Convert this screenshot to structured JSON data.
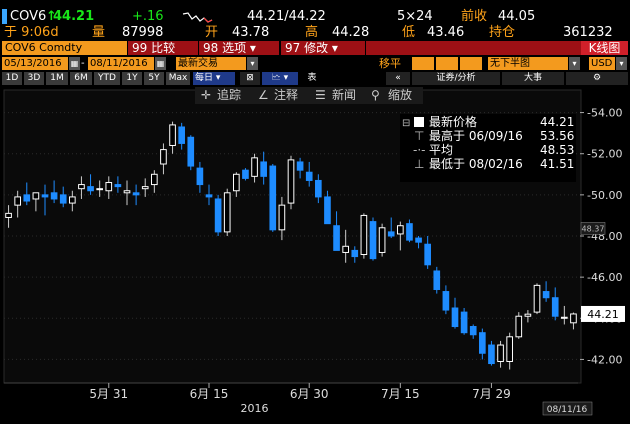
{
  "quote": {
    "ticker": "COV6",
    "last_price": "44.21",
    "change": "+.16",
    "bid_ask": "44.21/44.22",
    "size": "5×24",
    "prev_close_label": "前收",
    "prev_close": "44.05",
    "time": "于 9:06d",
    "volume_label": "量",
    "volume": "87998",
    "open_label": "开",
    "open": "43.78",
    "high_label": "高",
    "high": "44.28",
    "low_label": "低",
    "low": "43.46",
    "oi_label": "持仓",
    "oi": "361232"
  },
  "toolbar": {
    "security": "COV6 Comdty",
    "compare": "99 比较",
    "options": "98 选项 ▾",
    "edit": "97 修改 ▾",
    "chart_type": "K线图"
  },
  "dates": {
    "start": "05/13/2016",
    "end": "08/11/2016",
    "field": "最新交易",
    "shift_label": "移平",
    "currency_mode": "无下半图",
    "currency": "USD"
  },
  "ranges": [
    "1D",
    "3D",
    "1M",
    "6M",
    "YTD",
    "1Y",
    "5Y",
    "Max"
  ],
  "periodicity": "每日 ▾",
  "misc_buttons": {
    "compare_btn": "⊠",
    "type_btn": "🗠 ▾",
    "table_btn": "表",
    "collapse": "«",
    "events": "证券/分析",
    "annotate": "大事",
    "settings": "⚙"
  },
  "overlay_menu": {
    "track": "追踪",
    "annotate": "注释",
    "news": "新闻",
    "zoom": "缩放"
  },
  "legend": {
    "title": "最新价格",
    "last": "44.21",
    "high_label": "最高于 06/09/16",
    "high_value": "53.56",
    "avg_label": "平均",
    "avg_value": "48.53",
    "low_label": "最低于 08/02/16",
    "low_value": "41.51"
  },
  "chart_data": {
    "type": "candlestick",
    "y_ticks": [
      "54.00",
      "52.00",
      "50.00",
      "48.00",
      "46.00",
      "44.00",
      "42.00"
    ],
    "ylim": [
      41.0,
      55.0
    ],
    "x_ticks": [
      "5月 31",
      "6月 15",
      "6月 30",
      "7月 15",
      "7月 29"
    ],
    "year_label": "2016",
    "last_price_tag": "44.21",
    "ma_tag": "48.37",
    "end_date_tag": "08/11/16",
    "candles": [
      {
        "d": "05/13",
        "o": 48.9,
        "h": 49.5,
        "l": 48.4,
        "c": 49.1
      },
      {
        "d": "05/16",
        "o": 49.5,
        "h": 50.2,
        "l": 48.9,
        "c": 49.9
      },
      {
        "d": "05/17",
        "o": 50.0,
        "h": 50.6,
        "l": 49.5,
        "c": 49.7
      },
      {
        "d": "05/18",
        "o": 49.8,
        "h": 50.1,
        "l": 49.2,
        "c": 50.1
      },
      {
        "d": "05/19",
        "o": 50.0,
        "h": 50.5,
        "l": 49.0,
        "c": 49.9
      },
      {
        "d": "05/20",
        "o": 50.1,
        "h": 50.7,
        "l": 49.6,
        "c": 49.8
      },
      {
        "d": "05/23",
        "o": 50.0,
        "h": 50.4,
        "l": 49.4,
        "c": 49.6
      },
      {
        "d": "05/24",
        "o": 49.6,
        "h": 50.2,
        "l": 49.2,
        "c": 49.9
      },
      {
        "d": "05/25",
        "o": 50.3,
        "h": 50.9,
        "l": 49.8,
        "c": 50.5
      },
      {
        "d": "05/26",
        "o": 50.4,
        "h": 51.0,
        "l": 50.0,
        "c": 50.2
      },
      {
        "d": "05/27",
        "o": 50.3,
        "h": 50.7,
        "l": 49.9,
        "c": 50.3
      },
      {
        "d": "05/31",
        "o": 50.2,
        "h": 50.9,
        "l": 49.8,
        "c": 50.6
      },
      {
        "d": "06/01",
        "o": 50.5,
        "h": 50.9,
        "l": 50.1,
        "c": 50.4
      },
      {
        "d": "06/02",
        "o": 50.1,
        "h": 50.7,
        "l": 49.5,
        "c": 50.2
      },
      {
        "d": "06/03",
        "o": 50.1,
        "h": 50.5,
        "l": 49.5,
        "c": 50.0
      },
      {
        "d": "06/06",
        "o": 50.3,
        "h": 50.8,
        "l": 49.9,
        "c": 50.4
      },
      {
        "d": "06/07",
        "o": 50.5,
        "h": 51.2,
        "l": 50.1,
        "c": 51.0
      },
      {
        "d": "06/08",
        "o": 51.5,
        "h": 52.5,
        "l": 51.0,
        "c": 52.2
      },
      {
        "d": "06/09",
        "o": 52.4,
        "h": 53.56,
        "l": 52.0,
        "c": 53.4
      },
      {
        "d": "06/10",
        "o": 53.3,
        "h": 53.5,
        "l": 52.2,
        "c": 52.5
      },
      {
        "d": "06/13",
        "o": 52.8,
        "h": 52.9,
        "l": 51.2,
        "c": 51.4
      },
      {
        "d": "06/14",
        "o": 51.3,
        "h": 51.6,
        "l": 50.1,
        "c": 50.5
      },
      {
        "d": "06/15",
        "o": 50.0,
        "h": 50.5,
        "l": 49.5,
        "c": 49.9
      },
      {
        "d": "06/16",
        "o": 49.8,
        "h": 50.0,
        "l": 48.0,
        "c": 48.2
      },
      {
        "d": "06/17",
        "o": 48.2,
        "h": 50.3,
        "l": 48.0,
        "c": 50.1
      },
      {
        "d": "06/20",
        "o": 50.2,
        "h": 51.1,
        "l": 49.9,
        "c": 51.0
      },
      {
        "d": "06/21",
        "o": 51.2,
        "h": 51.3,
        "l": 50.7,
        "c": 50.8
      },
      {
        "d": "06/22",
        "o": 50.9,
        "h": 52.0,
        "l": 50.6,
        "c": 51.8
      },
      {
        "d": "06/23",
        "o": 51.6,
        "h": 52.1,
        "l": 50.5,
        "c": 50.9
      },
      {
        "d": "06/24",
        "o": 51.4,
        "h": 51.5,
        "l": 48.2,
        "c": 48.3
      },
      {
        "d": "06/27",
        "o": 48.3,
        "h": 49.9,
        "l": 47.8,
        "c": 49.5
      },
      {
        "d": "06/28",
        "o": 49.6,
        "h": 51.9,
        "l": 49.3,
        "c": 51.7
      },
      {
        "d": "06/29",
        "o": 51.6,
        "h": 51.8,
        "l": 50.8,
        "c": 51.2
      },
      {
        "d": "06/30",
        "o": 51.1,
        "h": 51.6,
        "l": 50.4,
        "c": 50.7
      },
      {
        "d": "07/01",
        "o": 50.7,
        "h": 51.0,
        "l": 49.6,
        "c": 49.9
      },
      {
        "d": "07/05",
        "o": 49.9,
        "h": 50.2,
        "l": 48.7,
        "c": 48.6
      },
      {
        "d": "07/06",
        "o": 48.5,
        "h": 49.2,
        "l": 47.3,
        "c": 47.3
      },
      {
        "d": "07/07",
        "o": 47.2,
        "h": 48.3,
        "l": 46.7,
        "c": 47.5
      },
      {
        "d": "07/08",
        "o": 47.3,
        "h": 47.5,
        "l": 46.7,
        "c": 47.0
      },
      {
        "d": "07/11",
        "o": 47.1,
        "h": 49.1,
        "l": 46.9,
        "c": 49.0
      },
      {
        "d": "07/12",
        "o": 48.7,
        "h": 48.9,
        "l": 46.8,
        "c": 46.9
      },
      {
        "d": "07/13",
        "o": 47.2,
        "h": 48.6,
        "l": 47.0,
        "c": 48.4
      },
      {
        "d": "07/14",
        "o": 48.2,
        "h": 48.9,
        "l": 47.9,
        "c": 48.0
      },
      {
        "d": "07/15",
        "o": 48.1,
        "h": 48.7,
        "l": 47.3,
        "c": 48.5
      },
      {
        "d": "07/18",
        "o": 48.6,
        "h": 48.8,
        "l": 47.7,
        "c": 47.8
      },
      {
        "d": "07/19",
        "o": 47.9,
        "h": 48.0,
        "l": 47.4,
        "c": 47.7
      },
      {
        "d": "07/20",
        "o": 47.6,
        "h": 48.0,
        "l": 46.4,
        "c": 46.6
      },
      {
        "d": "07/21",
        "o": 46.3,
        "h": 46.5,
        "l": 45.2,
        "c": 45.4
      },
      {
        "d": "07/22",
        "o": 45.3,
        "h": 45.6,
        "l": 44.2,
        "c": 44.4
      },
      {
        "d": "07/25",
        "o": 44.5,
        "h": 45.0,
        "l": 43.5,
        "c": 43.6
      },
      {
        "d": "07/26",
        "o": 44.3,
        "h": 44.5,
        "l": 43.2,
        "c": 43.3
      },
      {
        "d": "07/27",
        "o": 43.6,
        "h": 43.7,
        "l": 43.0,
        "c": 43.2
      },
      {
        "d": "07/28",
        "o": 43.3,
        "h": 43.5,
        "l": 42.0,
        "c": 42.3
      },
      {
        "d": "07/29",
        "o": 42.7,
        "h": 42.9,
        "l": 41.7,
        "c": 41.8
      },
      {
        "d": "08/01",
        "o": 41.9,
        "h": 42.9,
        "l": 41.6,
        "c": 42.7
      },
      {
        "d": "08/02",
        "o": 41.9,
        "h": 43.3,
        "l": 41.51,
        "c": 43.1
      },
      {
        "d": "08/03",
        "o": 43.1,
        "h": 44.3,
        "l": 43.0,
        "c": 44.1
      },
      {
        "d": "08/04",
        "o": 44.1,
        "h": 44.4,
        "l": 43.8,
        "c": 44.2
      },
      {
        "d": "08/05",
        "o": 44.3,
        "h": 45.7,
        "l": 44.2,
        "c": 45.6
      },
      {
        "d": "08/08",
        "o": 45.3,
        "h": 45.8,
        "l": 44.8,
        "c": 45.0
      },
      {
        "d": "08/09",
        "o": 45.0,
        "h": 45.5,
        "l": 43.9,
        "c": 44.1
      },
      {
        "d": "08/10",
        "o": 44.0,
        "h": 44.6,
        "l": 43.7,
        "c": 44.05
      },
      {
        "d": "08/11",
        "o": 43.78,
        "h": 44.28,
        "l": 43.46,
        "c": 44.21
      }
    ]
  }
}
